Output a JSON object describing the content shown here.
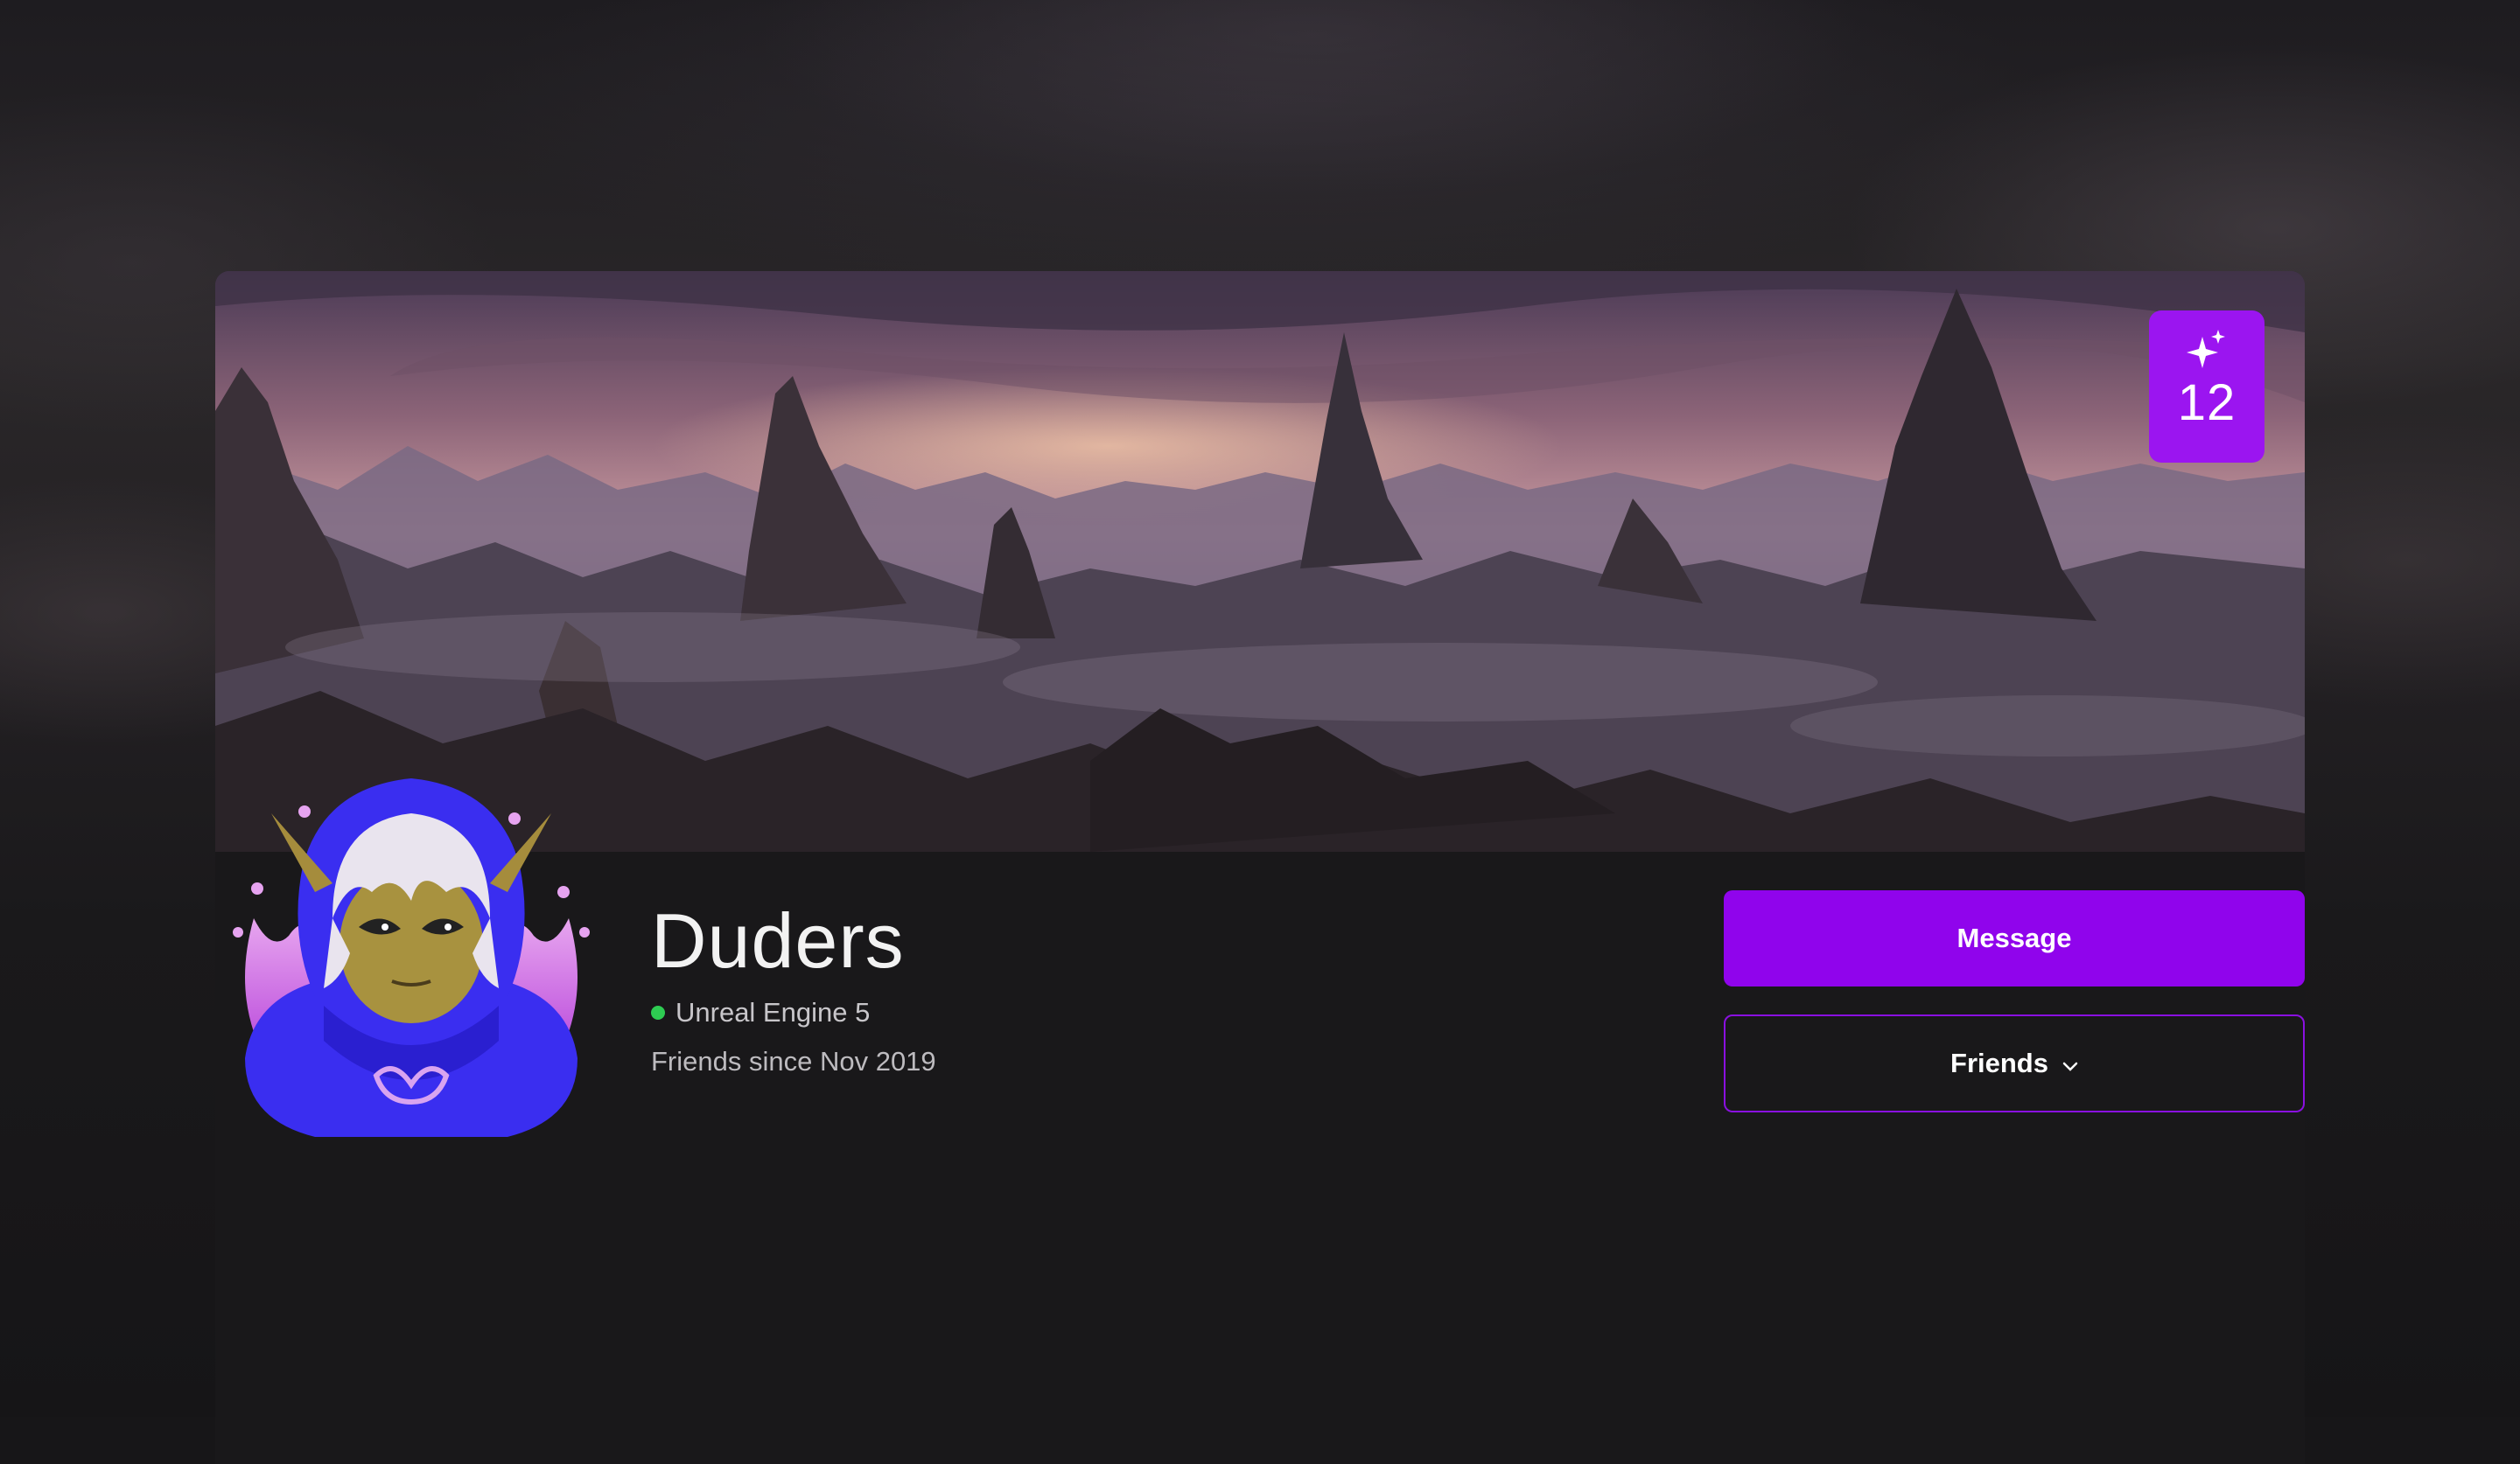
{
  "profile": {
    "display_name": "Duders",
    "presence_text": "Unreal Engine 5",
    "presence_color": "#2ecc52",
    "friends_since": "Friends since Nov 2019",
    "achievement_count": "12",
    "achievement_icon": "sparkle-icon"
  },
  "actions": {
    "message_label": "Message",
    "friends_label": "Friends",
    "friends_icon": "chevron-down-icon"
  },
  "colors": {
    "accent": "#9004ec",
    "badge": "#9b15f0",
    "background": "#171618"
  }
}
